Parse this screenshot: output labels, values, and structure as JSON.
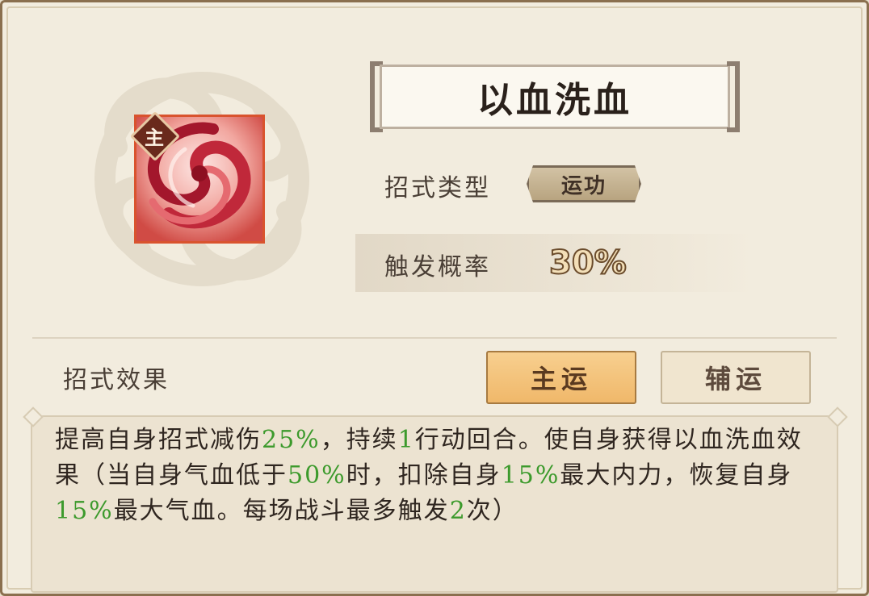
{
  "skill": {
    "name": "以血洗血",
    "role_badge": "主",
    "icon": "crimson-spiral-icon"
  },
  "info": {
    "type_label": "招式类型",
    "type_value": "运功",
    "rate_label": "触发概率",
    "rate_value": "30%"
  },
  "effect": {
    "section_label": "招式效果",
    "tabs": {
      "main": "主运",
      "aux": "辅运"
    },
    "selected_tab": "main",
    "segments": [
      {
        "t": "提高自身招式减伤",
        "hl": false
      },
      {
        "t": "25%",
        "hl": true
      },
      {
        "t": "，持续",
        "hl": false
      },
      {
        "t": "1",
        "hl": true
      },
      {
        "t": "行动回合。使自身获得以血洗血效果（当自身气血低于",
        "hl": false
      },
      {
        "t": "50%",
        "hl": true
      },
      {
        "t": "时，扣除自身",
        "hl": false
      },
      {
        "t": "15%",
        "hl": true
      },
      {
        "t": "最大内力，恢复自身",
        "hl": false
      },
      {
        "t": "15%",
        "hl": true
      },
      {
        "t": "最大气血。每场战斗最多触发",
        "hl": false
      },
      {
        "t": "2",
        "hl": true
      },
      {
        "t": "次）",
        "hl": false
      }
    ]
  },
  "colors": {
    "highlight": "#3c9a2c",
    "accent_button": "#f0b86a",
    "icon_border": "#d9532e"
  }
}
